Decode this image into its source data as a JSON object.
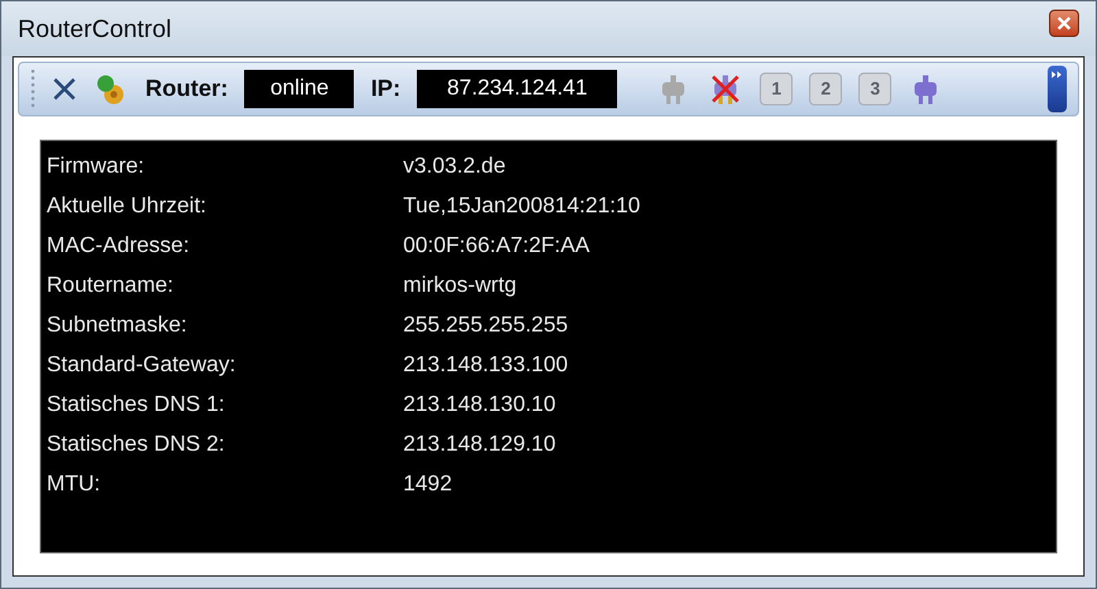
{
  "window": {
    "title": "RouterControl"
  },
  "toolbar": {
    "router_label": "Router:",
    "router_status": "online",
    "ip_label": "IP:",
    "ip_value": "87.234.124.41",
    "buttons": [
      {
        "kind": "plug",
        "disabled": true
      },
      {
        "kind": "disconnect",
        "disabled": false
      },
      {
        "kind": "number",
        "label": "1",
        "disabled": true
      },
      {
        "kind": "number",
        "label": "2",
        "disabled": true
      },
      {
        "kind": "number",
        "label": "3",
        "disabled": true
      },
      {
        "kind": "connect",
        "disabled": false
      }
    ]
  },
  "info": [
    {
      "label": "Firmware:",
      "value": "v3.03.2.de"
    },
    {
      "label": "Aktuelle Uhrzeit:",
      "value": "Tue,15Jan200814:21:10"
    },
    {
      "label": "MAC-Adresse:",
      "value": "00:0F:66:A7:2F:AA"
    },
    {
      "label": "Routername:",
      "value": "mirkos-wrtg"
    },
    {
      "label": "Subnetmaske:",
      "value": "255.255.255.255"
    },
    {
      "label": "Standard-Gateway:",
      "value": "213.148.133.100"
    },
    {
      "label": "Statisches DNS 1:",
      "value": "213.148.130.10"
    },
    {
      "label": "Statisches DNS 2:",
      "value": "213.148.129.10"
    },
    {
      "label": "MTU:",
      "value": "1492"
    }
  ]
}
